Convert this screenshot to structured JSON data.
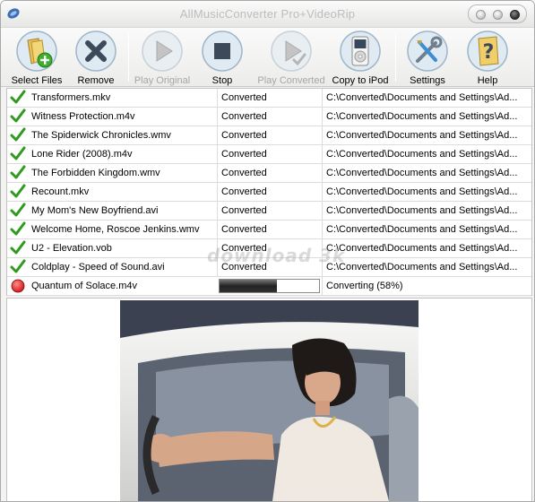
{
  "window": {
    "title": "AllMusicConverter Pro+VideoRip"
  },
  "toolbar": {
    "select_files": "Select Files",
    "remove": "Remove",
    "play_original": "Play Original",
    "stop": "Stop",
    "play_converted": "Play Converted",
    "copy_to_ipod": "Copy to iPod",
    "settings": "Settings",
    "help": "Help"
  },
  "files": [
    {
      "name": "Transformers.mkv",
      "status": "Converted",
      "path": "C:\\Converted\\Documents and Settings\\Ad...",
      "state": "done"
    },
    {
      "name": "Witness Protection.m4v",
      "status": "Converted",
      "path": "C:\\Converted\\Documents and Settings\\Ad...",
      "state": "done"
    },
    {
      "name": "The Spiderwick Chronicles.wmv",
      "status": "Converted",
      "path": "C:\\Converted\\Documents and Settings\\Ad...",
      "state": "done"
    },
    {
      "name": "Lone Rider (2008).m4v",
      "status": "Converted",
      "path": "C:\\Converted\\Documents and Settings\\Ad...",
      "state": "done"
    },
    {
      "name": "The Forbidden Kingdom.wmv",
      "status": "Converted",
      "path": "C:\\Converted\\Documents and Settings\\Ad...",
      "state": "done"
    },
    {
      "name": "Recount.mkv",
      "status": "Converted",
      "path": "C:\\Converted\\Documents and Settings\\Ad...",
      "state": "done"
    },
    {
      "name": "My Mom's New Boyfriend.avi",
      "status": "Converted",
      "path": "C:\\Converted\\Documents and Settings\\Ad...",
      "state": "done"
    },
    {
      "name": "Welcome Home, Roscoe Jenkins.wmv",
      "status": "Converted",
      "path": "C:\\Converted\\Documents and Settings\\Ad...",
      "state": "done"
    },
    {
      "name": "U2 - Elevation.vob",
      "status": "Converted",
      "path": "C:\\Converted\\Documents and Settings\\Ad...",
      "state": "done"
    },
    {
      "name": "Coldplay - Speed of Sound.avi",
      "status": "Converted",
      "path": "C:\\Converted\\Documents and Settings\\Ad...",
      "state": "done"
    },
    {
      "name": "Quantum of Solace.m4v",
      "status": "",
      "path": "Converting (58%)",
      "state": "converting",
      "progress": 0.58
    }
  ],
  "watermark": "download 3k",
  "colors": {
    "check": "#2e9a1e",
    "converting_dot": "#d01010",
    "progress_fill": "#2b2b2b"
  }
}
